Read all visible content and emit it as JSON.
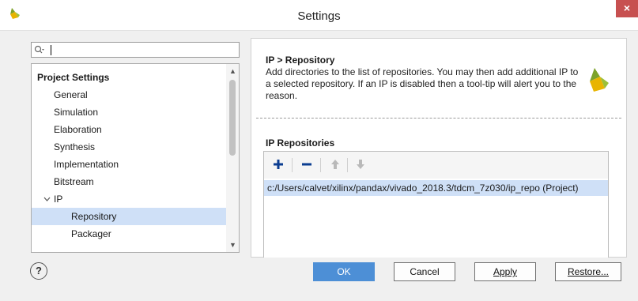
{
  "window": {
    "title": "Settings",
    "close_glyph": "×"
  },
  "search": {
    "value": "",
    "placeholder": ""
  },
  "tree": {
    "items": [
      {
        "label": "Project Settings",
        "bold": true,
        "level": 0
      },
      {
        "label": "General",
        "level": 1
      },
      {
        "label": "Simulation",
        "level": 1
      },
      {
        "label": "Elaboration",
        "level": 1
      },
      {
        "label": "Synthesis",
        "level": 1
      },
      {
        "label": "Implementation",
        "level": 1
      },
      {
        "label": "Bitstream",
        "level": 1
      },
      {
        "label": "IP",
        "level": 1,
        "expanded": true
      },
      {
        "label": "Repository",
        "level": 2,
        "selected": true
      },
      {
        "label": "Packager",
        "level": 2
      }
    ]
  },
  "detail": {
    "heading": "IP > Repository",
    "description": "Add directories to the list of repositories. You may then add additional IP to a selected repository. If an IP is disabled then a tool-tip will alert you to the reason.",
    "section_title": "IP Repositories",
    "toolbar": {
      "add_icon": "plus-icon",
      "remove_icon": "minus-icon",
      "up_icon": "arrow-up-icon",
      "down_icon": "arrow-down-icon"
    },
    "repositories": [
      "c:/Users/calvet/xilinx/pandax/vivado_2018.3/tdcm_7z030/ip_repo (Project)"
    ]
  },
  "buttons": {
    "help": "?",
    "ok": "OK",
    "cancel": "Cancel",
    "apply": "Apply",
    "restore": "Restore..."
  },
  "colors": {
    "selection": "#cfe0f7",
    "ok_button": "#4d8fd6",
    "close_button": "#c75050",
    "brand_green": "#7da229",
    "brand_yellow": "#e8b400"
  }
}
